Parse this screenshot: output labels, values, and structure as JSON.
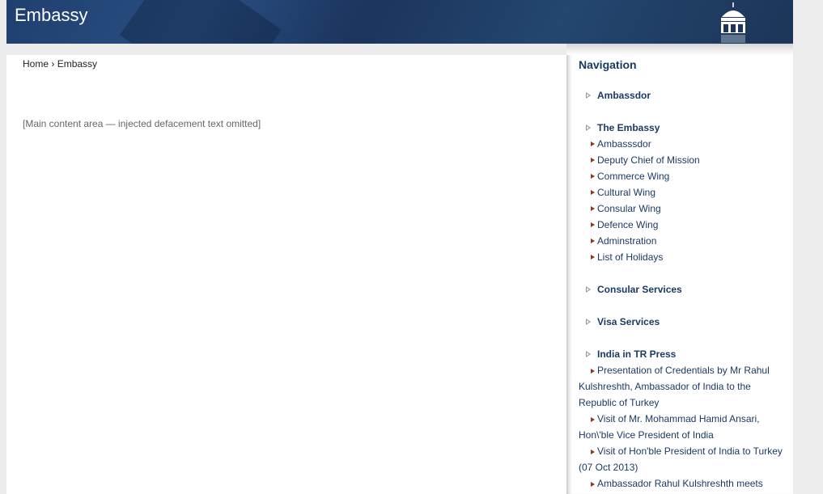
{
  "header": {
    "title": "Embassy",
    "logo_icon": "dome-icon"
  },
  "breadcrumb": {
    "home": "Home",
    "separator": "›",
    "current": "Embassy"
  },
  "main": {
    "note": "[Main content area — injected defacement text omitted]"
  },
  "sidebar": {
    "title": "Navigation",
    "sections": [
      {
        "label": "Ambassdor",
        "items": []
      },
      {
        "label": "The Embassy",
        "items": [
          "Ambasssdor",
          "Deputy Chief of Mission",
          "Commerce Wing",
          "Cultural Wing",
          "Consular Wing",
          "Defence Wing",
          "Adminstration",
          "List of Holidays"
        ]
      },
      {
        "label": "Consular Services",
        "items": []
      },
      {
        "label": "Visa Services",
        "items": []
      },
      {
        "label": "India in TR Press",
        "press": [
          "Presentation of Credentials by Mr Rahul Kulshreshth, Ambassador of India to the Republic of Turkey",
          "Visit of Mr. Mohammad Hamid Ansari, Hon\\'ble Vice President of India",
          "Visit of Hon'ble President of India to Turkey (07 Oct 2013)",
          "Ambassador Rahul Kulshreshth meets"
        ]
      }
    ]
  }
}
